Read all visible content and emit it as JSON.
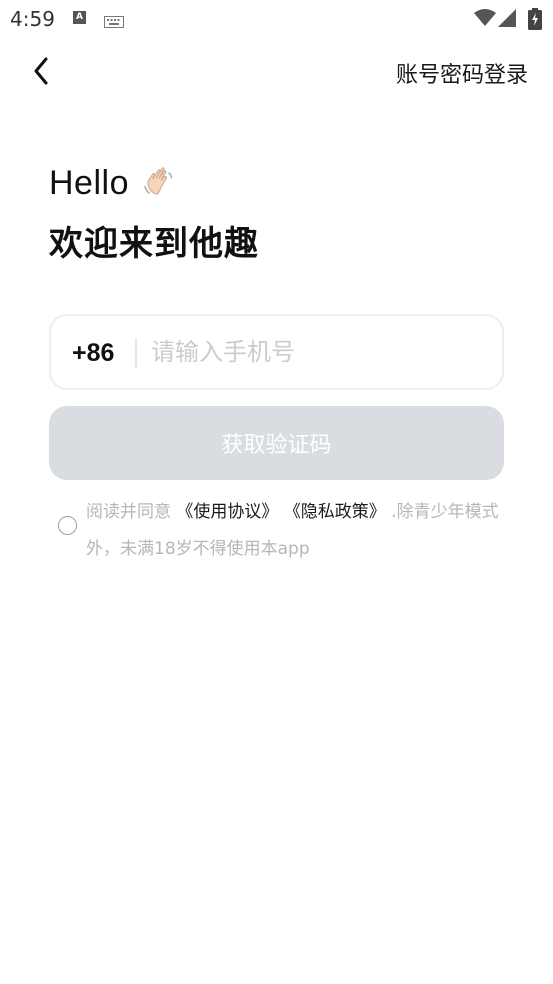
{
  "status_bar": {
    "time": "4:59",
    "notification_a": "A",
    "icons": [
      "keyboard-icon",
      "wifi-icon",
      "signal-icon",
      "battery-icon"
    ]
  },
  "nav": {
    "back_icon": "chevron-left-icon",
    "account_login": "账号密码登录"
  },
  "greeting": {
    "hello": "Hello",
    "wave_icon": "waving-hand-icon",
    "welcome": "欢迎来到他趣"
  },
  "phone": {
    "country_code": "+86",
    "placeholder": "请输入手机号",
    "value": ""
  },
  "get_code_button": "获取验证码",
  "agreement": {
    "checked": false,
    "prefix": "阅读并同意",
    "terms": "《使用协议》",
    "privacy": "《隐私政策》",
    "suffix": ".除青少年模式外，未满18岁不得使用本app"
  },
  "colors": {
    "button_disabled": "#d9dce0",
    "input_border": "#eceef1",
    "placeholder": "#c9ccd1",
    "hint_text": "#b3b6bb"
  }
}
